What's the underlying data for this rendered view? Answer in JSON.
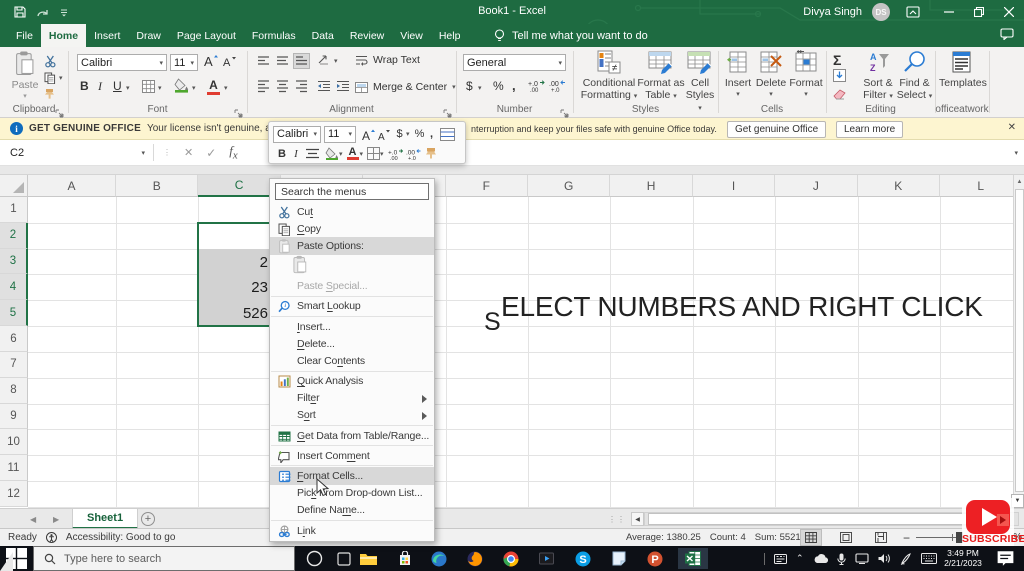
{
  "titlebar": {
    "title": "Book1 - Excel",
    "user": "Divya Singh",
    "avatar_initials": "DS"
  },
  "tabs": {
    "items": [
      {
        "label": "File"
      },
      {
        "label": "Home",
        "active": true
      },
      {
        "label": "Insert"
      },
      {
        "label": "Draw"
      },
      {
        "label": "Page Layout"
      },
      {
        "label": "Formulas"
      },
      {
        "label": "Data"
      },
      {
        "label": "Review"
      },
      {
        "label": "View"
      },
      {
        "label": "Help"
      }
    ],
    "tellme": "Tell me what you want to do"
  },
  "ribbon": {
    "clipboard": {
      "label": "Clipboard",
      "paste": "Paste"
    },
    "font": {
      "label": "Font",
      "font_name": "Calibri",
      "font_size": "11"
    },
    "alignment": {
      "label": "Alignment",
      "wrap_text": "Wrap Text",
      "merge_center": "Merge & Center"
    },
    "number": {
      "label": "Number",
      "format": "General"
    },
    "styles": {
      "label": "Styles",
      "b1a": "Conditional",
      "b1b": "Formatting",
      "b2a": "Format as",
      "b2b": "Table",
      "b3a": "Cell",
      "b3b": "Styles"
    },
    "cells": {
      "label": "Cells",
      "b1": "Insert",
      "b2": "Delete",
      "b3": "Format"
    },
    "editing": {
      "label": "Editing",
      "b1a": "Sort &",
      "b1b": "Filter",
      "b2a": "Find &",
      "b2b": "Select"
    },
    "officeatwork": {
      "label": "officeatwork",
      "b1": "Templates"
    }
  },
  "banner": {
    "badge": "GET GENUINE OFFICE",
    "msg_left": "Your license isn't genuine, and you m",
    "msg_right": "nterruption and keep your files safe with genuine Office today.",
    "btn_get": "Get genuine Office",
    "btn_learn": "Learn more",
    "close": "✕"
  },
  "formulabar": {
    "namebox": "C2",
    "fx": "fx"
  },
  "minitoolbar": {
    "font_name": "Calibri",
    "font_size": "11"
  },
  "grid": {
    "columns": [
      "A",
      "B",
      "C",
      "D",
      "E",
      "F",
      "G",
      "H",
      "I",
      "J",
      "K",
      "L"
    ],
    "selected_column": "C",
    "rows": [
      "1",
      "2",
      "3",
      "4",
      "5",
      "6",
      "7",
      "8",
      "9",
      "10",
      "11",
      "12"
    ],
    "selected_rows": [
      "2",
      "3",
      "4",
      "5"
    ],
    "visible_cell_values": [
      {
        "row": "3",
        "text": "2"
      },
      {
        "row": "4",
        "text": "23"
      },
      {
        "row": "5",
        "text": "526"
      }
    ]
  },
  "overlay_caption": {
    "lead": "S",
    "rest": "ELECT NUMBERS AND RIGHT CLICK"
  },
  "context_menu": {
    "search_placeholder": "Search the menus",
    "items": [
      {
        "label": "Cut",
        "u": 2,
        "icon": "cut"
      },
      {
        "label": "Copy",
        "u": 0,
        "icon": "copy"
      },
      {
        "label": "Paste Options:",
        "state": "hl",
        "icon": "paste-sm"
      },
      {
        "type": "iconrow",
        "icon": "paste-lg"
      },
      {
        "label": "Paste Special...",
        "u": 6,
        "state": "dis"
      },
      {
        "type": "sep"
      },
      {
        "label": "Smart Lookup",
        "u": 6,
        "icon": "lookup"
      },
      {
        "type": "sep"
      },
      {
        "label": "Insert...",
        "u": 0
      },
      {
        "label": "Delete...",
        "u": 0
      },
      {
        "label": "Clear Contents",
        "u": 8
      },
      {
        "type": "sep"
      },
      {
        "label": "Quick Analysis",
        "u": 0,
        "icon": "quick"
      },
      {
        "label": "Filter",
        "u": 4,
        "sub": true
      },
      {
        "label": "Sort",
        "u": 1,
        "sub": true
      },
      {
        "type": "sep"
      },
      {
        "label": "Get Data from Table/Range...",
        "u": 0,
        "icon": "getdata"
      },
      {
        "type": "sep"
      },
      {
        "label": "Insert Comment",
        "u": 10,
        "icon": "comment"
      },
      {
        "type": "sep"
      },
      {
        "label": "Format Cells...",
        "u": 0,
        "state": "hl",
        "icon": "fmtcells"
      },
      {
        "label": "Pick From Drop-down List...",
        "u": 3
      },
      {
        "label": "Define Name...",
        "u": 9
      },
      {
        "type": "sep"
      },
      {
        "label": "Link",
        "u": 1,
        "icon": "link"
      }
    ]
  },
  "sheetbar": {
    "tab": "Sheet1"
  },
  "statusbar": {
    "ready": "Ready",
    "accessibility": "Accessibility: Good to go",
    "average": "Average: 1380.25",
    "count": "Count: 4",
    "sum": "Sum: 5521",
    "percent_sign": "%"
  },
  "subscribe": {
    "label": "SUBSCRIBE"
  },
  "taskbar": {
    "search_placeholder": "Type here to search",
    "time": "3:49 PM",
    "date": "2/21/2023"
  }
}
